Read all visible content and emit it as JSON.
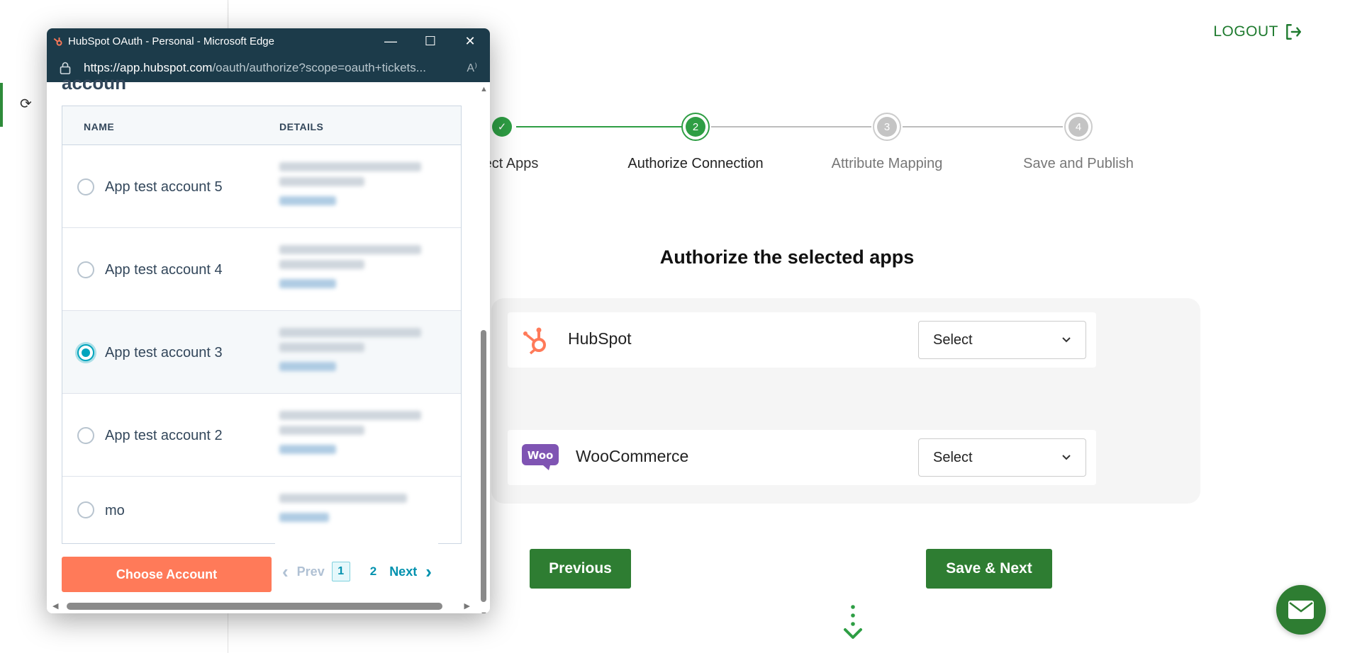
{
  "app": {
    "logout_label": "LOGOUT"
  },
  "stepper": {
    "steps": [
      {
        "label": "ect Apps",
        "number": "",
        "state": "done"
      },
      {
        "label": "Authorize Connection",
        "number": "2",
        "state": "active"
      },
      {
        "label": "Attribute Mapping",
        "number": "3",
        "state": "pending"
      },
      {
        "label": "Save and Publish",
        "number": "4",
        "state": "pending"
      }
    ],
    "colors": {
      "done": "#2e9e44",
      "active": "#2e9e44",
      "pending": "#c4c4c4"
    }
  },
  "authorize": {
    "title": "Authorize the selected apps",
    "source_app": {
      "name": "HubSpot",
      "select_value": "Select",
      "logo_color": "#ff7a59"
    },
    "target_app": {
      "name": "WooCommerce",
      "select_value": "Select",
      "logo_color": "#7f54b3",
      "logo_text": "Woo"
    },
    "previous_label": "Previous",
    "save_next_label": "Save & Next"
  },
  "popup": {
    "title": "HubSpot OAuth - Personal - Microsoft Edge",
    "url_host": "https://app.hubspot.com",
    "url_path": "/oauth/authorize?scope=oauth+tickets...",
    "heading_fragment": "accoun",
    "table": {
      "col_name": "NAME",
      "col_details": "DETAILS",
      "rows": [
        {
          "name": "App test account 5",
          "selected": false
        },
        {
          "name": "App test account 4",
          "selected": false
        },
        {
          "name": "App test account 3",
          "selected": true
        },
        {
          "name": "App test account 2",
          "selected": false
        },
        {
          "name": "mo",
          "selected": false
        }
      ]
    },
    "choose_label": "Choose Account",
    "pager": {
      "prev": "Prev",
      "current": "1",
      "page2": "2",
      "next": "Next"
    }
  },
  "colors": {
    "brand_green": "#2e7d32",
    "hubspot_orange": "#ff7a59",
    "hubspot_teal": "#00a4bd",
    "edge_titlebar": "#1c3b4a"
  }
}
